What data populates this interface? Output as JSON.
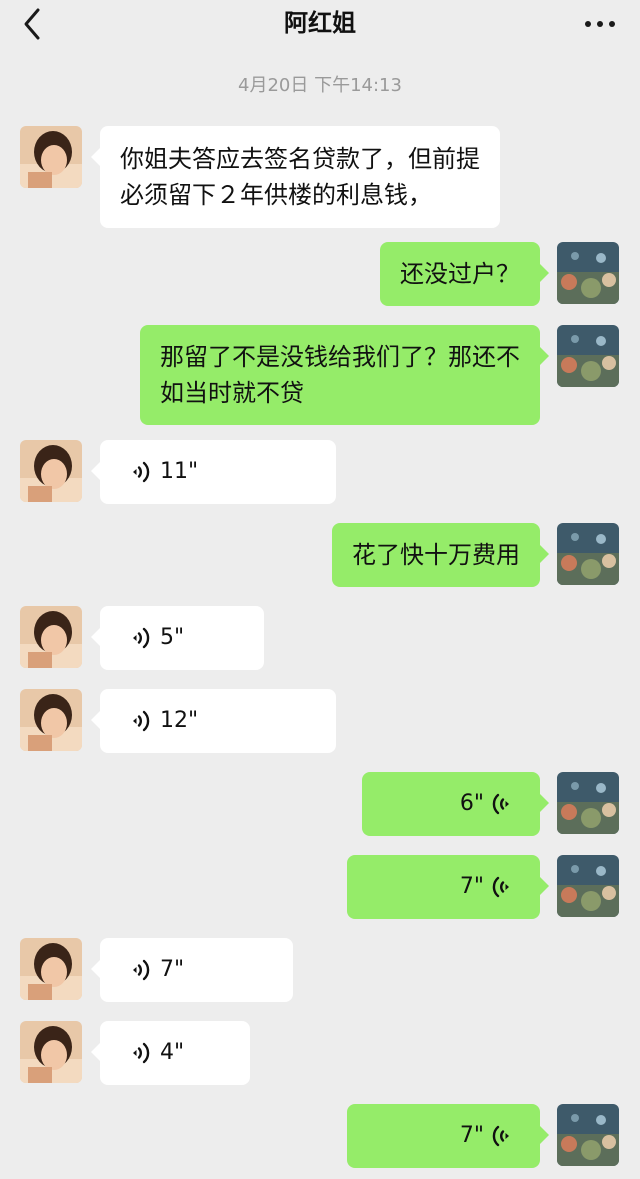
{
  "header": {
    "title": "阿红姐"
  },
  "timestamp": "4月20日 下午14:13",
  "messages": [
    {
      "side": "in",
      "type": "text",
      "lines": [
        "你姐夫答应去签名贷款了，但前提",
        "必须留下２年供楼的利息钱，"
      ]
    },
    {
      "side": "out",
      "type": "text",
      "lines": [
        "还没过户？"
      ]
    },
    {
      "side": "out",
      "type": "text",
      "lines": [
        "那留了不是没钱给我们了？那还不",
        "如当时就不贷"
      ]
    },
    {
      "side": "in",
      "type": "voice",
      "duration": "11\""
    },
    {
      "side": "out",
      "type": "text",
      "lines": [
        "花了快十万费用"
      ]
    },
    {
      "side": "in",
      "type": "voice",
      "duration": "5\""
    },
    {
      "side": "in",
      "type": "voice",
      "duration": "12\""
    },
    {
      "side": "out",
      "type": "voice",
      "duration": "6\""
    },
    {
      "side": "out",
      "type": "voice",
      "duration": "7\""
    },
    {
      "side": "in",
      "type": "voice",
      "duration": "7\""
    },
    {
      "side": "in",
      "type": "voice",
      "duration": "4\""
    },
    {
      "side": "out",
      "type": "voice",
      "duration": "7\""
    }
  ],
  "icons": {
    "back": "chevron-left-icon",
    "more": "more-dots-icon",
    "voice_in": "voice-wave-icon",
    "voice_out": "voice-wave-icon"
  },
  "colors": {
    "background": "#ededed",
    "outgoing_bubble": "#95ec69",
    "incoming_bubble": "#ffffff",
    "timestamp_text": "#9a9a9a"
  }
}
